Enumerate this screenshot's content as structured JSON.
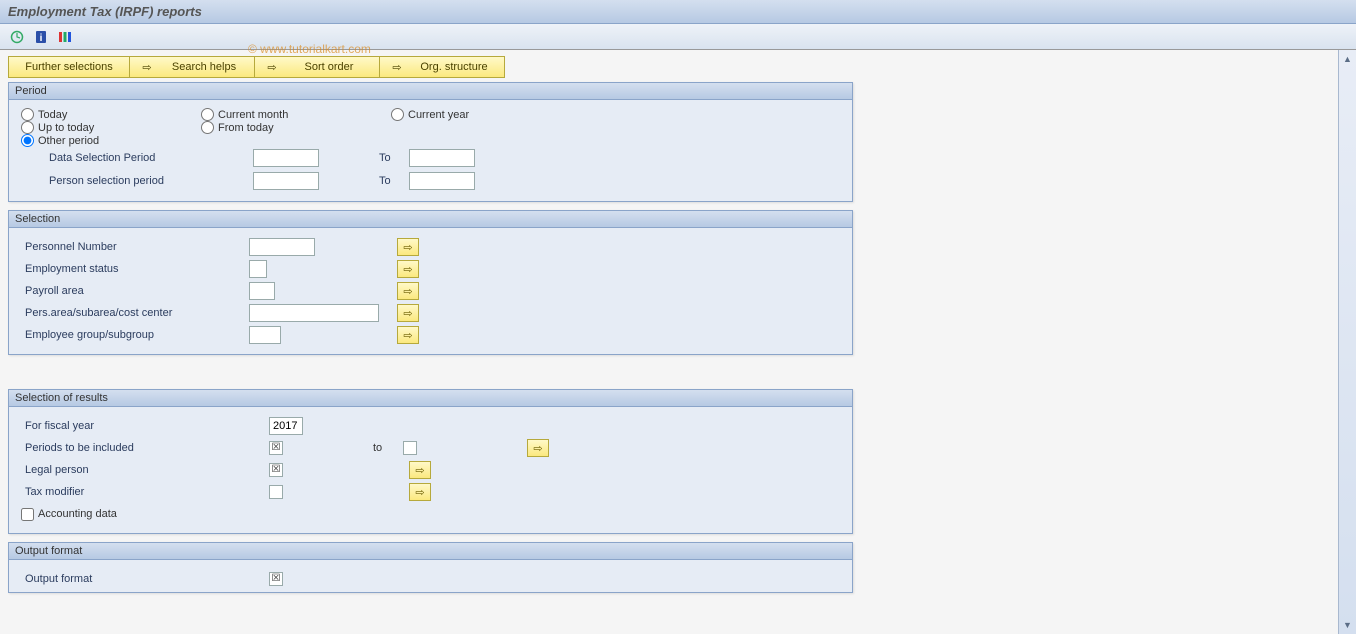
{
  "title": "Employment Tax (IRPF) reports",
  "watermark": "© www.tutorialkart.com",
  "toolbar": {
    "icons": {
      "execute": "⊕",
      "info": "ℹ",
      "color": "≡"
    }
  },
  "nav": {
    "further_selections": "Further selections",
    "search_helps": "Search helps",
    "sort_order": "Sort order",
    "org_structure": "Org. structure"
  },
  "groups": {
    "period": {
      "title": "Period",
      "radios": {
        "today": "Today",
        "current_month": "Current month",
        "current_year": "Current year",
        "up_to_today": "Up to today",
        "from_today": "From today",
        "other_period": "Other period"
      },
      "fields": {
        "data_sel_period": "Data Selection Period",
        "person_sel_period": "Person selection period",
        "to": "To"
      }
    },
    "selection": {
      "title": "Selection",
      "labels": {
        "personnel_number": "Personnel Number",
        "employment_status": "Employment status",
        "payroll_area": "Payroll area",
        "pers_area": "Pers.area/subarea/cost center",
        "emp_group": "Employee group/subgroup"
      }
    },
    "results": {
      "title": "Selection of results",
      "labels": {
        "fiscal_year": "For fiscal year",
        "periods": "Periods to be included",
        "to": "to",
        "legal_person": "Legal person",
        "tax_modifier": "Tax modifier",
        "accounting": "Accounting data"
      },
      "values": {
        "fiscal_year": "2017"
      }
    },
    "output": {
      "title": "Output format",
      "labels": {
        "output_format": "Output format"
      }
    }
  }
}
